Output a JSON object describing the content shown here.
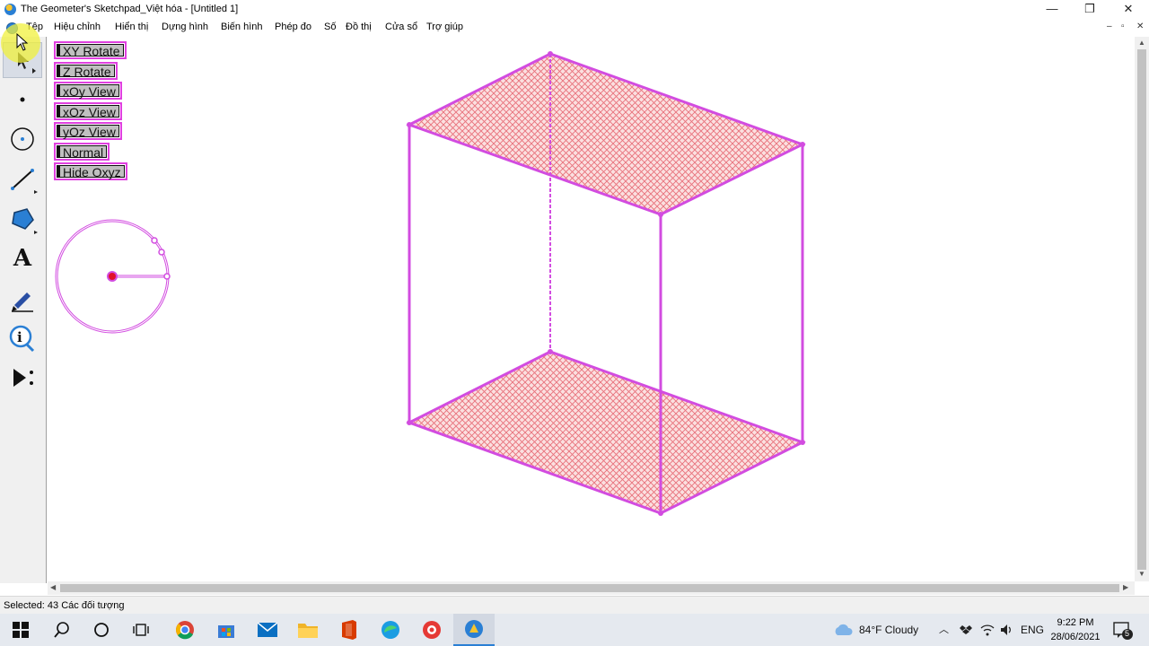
{
  "window": {
    "title": "The Geometer's Sketchpad_Việt hóa - [Untitled 1]",
    "minimize": "—",
    "restore": "❐",
    "close": "✕"
  },
  "menubar": {
    "items": [
      "Tệp",
      "Hiệu chỉnh",
      "Hiển thị",
      "Dựng hình",
      "Biến hình",
      "Phép đo",
      "Số",
      "Đồ thị",
      "Cửa sổ",
      "Trợ giúp"
    ],
    "mdi_min": "–",
    "mdi_restore": "▫",
    "mdi_close": "✕"
  },
  "toolbox": {
    "tools": [
      "arrow-select-icon",
      "point-icon",
      "compass-icon",
      "straightedge-icon",
      "polygon-icon",
      "text-icon",
      "marker-icon",
      "information-icon",
      "custom-tool-icon"
    ],
    "text_tool_glyph": "A",
    "info_glyph": "i"
  },
  "action_buttons": [
    "XY Rotate",
    "Z Rotate",
    "xOy View",
    "xOz View",
    "yOz View",
    "Normal",
    "Hide Oxyz"
  ],
  "canvas": {
    "accent_color": "#e040e0",
    "face_fill": "#f28a8a"
  },
  "statusbar": {
    "text": "Selected: 43 Các đối tượng"
  },
  "taskbar": {
    "apps": [
      "search-icon",
      "cortana-icon",
      "task-view-icon",
      "chrome-icon",
      "store-icon",
      "mail-icon",
      "file-explorer-icon",
      "office-icon",
      "edge-icon",
      "app-icon",
      "sketchpad-icon"
    ],
    "weather": "84°F  Cloudy",
    "language": "ENG",
    "time": "9:22 PM",
    "date": "28/06/2021",
    "notification_count": "5"
  }
}
